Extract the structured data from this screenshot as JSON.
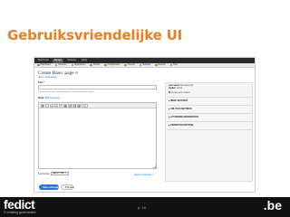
{
  "slide": {
    "title": "Gebruiksvriendelijke UI",
    "page_number": "p. 16",
    "logo_left": "fedict",
    "logo_left_tagline": "© creating government",
    "logo_right": ".be"
  },
  "toolbar": {
    "items": [
      "Back to site",
      "Manage",
      "Shortcuts",
      "admin"
    ],
    "active_index": 1
  },
  "shortcuts": {
    "items": [
      "Dashboard",
      "Structure",
      "Appearance",
      "People",
      "Configuration",
      "Content",
      "Modules",
      "Reports",
      "Help"
    ]
  },
  "page": {
    "title": "Create Basic page",
    "breadcrumb": "Home » Add content",
    "title_label": "Title",
    "title_required": "*",
    "title_help": "The title of the node. Shown in places such as listings of nodes.",
    "body_label": "Body",
    "body_link": "(Edit summary)",
    "editor_buttons": [
      "B",
      "I",
      "≡",
      "≡",
      "❝",
      "▣",
      "⛓",
      "⛓",
      "▦",
      "</>"
    ]
  },
  "text_format": {
    "label": "Text format",
    "selected": "Basic HTML",
    "info_link": "About text formats"
  },
  "actions": {
    "save": "Save and publish",
    "preview": "Preview"
  },
  "sidebar": {
    "last_saved_label": "Last saved:",
    "last_saved_value": "Not saved yet",
    "author_label": "Author:",
    "author_value": "admin",
    "revision_label": "Create new revision",
    "sections": [
      "MENU SETTINGS",
      "URL PATH SETTINGS",
      "AUTHORING INFORMATION",
      "PROMOTION OPTIONS"
    ]
  },
  "colors": {
    "title_orange": "#e87f22",
    "primary_blue": "#2d6fd2",
    "link_blue": "#0074bd"
  }
}
